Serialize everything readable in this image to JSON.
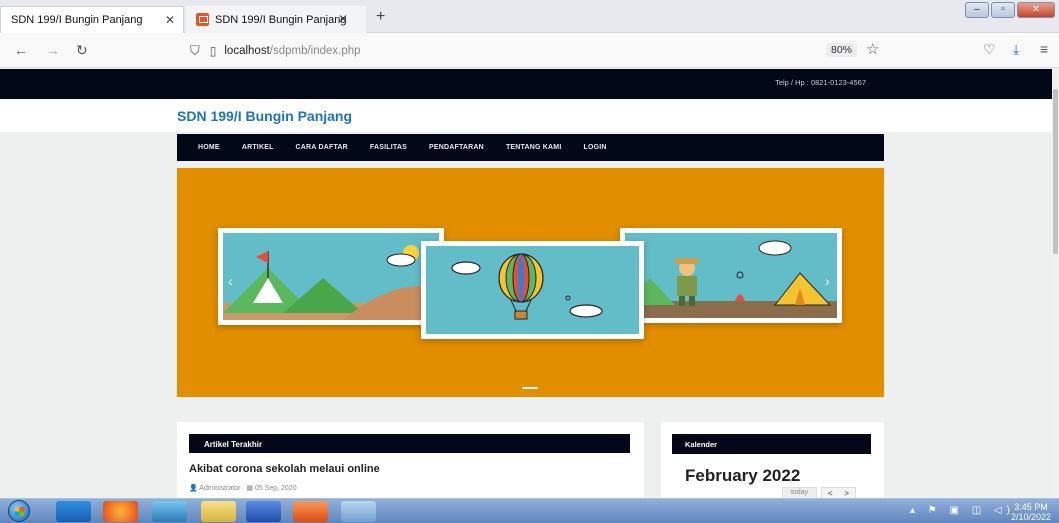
{
  "browser": {
    "tabs": [
      {
        "label": "SDN 199/I Bungin Panjang",
        "active": false
      },
      {
        "label": "SDN 199/I Bungin Panjang",
        "active": true
      }
    ],
    "url_host": "localhost",
    "url_path": "/sdpmb/index.php",
    "zoom": "80%"
  },
  "site": {
    "phone": "Telp / Hp : 0821-0123-4567",
    "brand": "SDN 199/I Bungin Panjang",
    "nav": [
      "HOME",
      "ARTIKEL",
      "CARA DAFTAR",
      "FASILITAS",
      "PENDAFTARAN",
      "TENTANG KAMI",
      "LOGIN"
    ]
  },
  "article": {
    "header": "Artikel Terakhir",
    "title": "Akibat corona sekolah melaui online",
    "author": "Administrator",
    "date": "05 Sep, 2020"
  },
  "calendar": {
    "header": "Kalender",
    "month": "February 2022",
    "today_label": "today"
  },
  "taskbar": {
    "time": "3:45 PM",
    "date": "2/10/2022"
  },
  "colors": {
    "dark": "#020817",
    "brand": "#1e73be",
    "slider_bg": "#e18e00"
  }
}
